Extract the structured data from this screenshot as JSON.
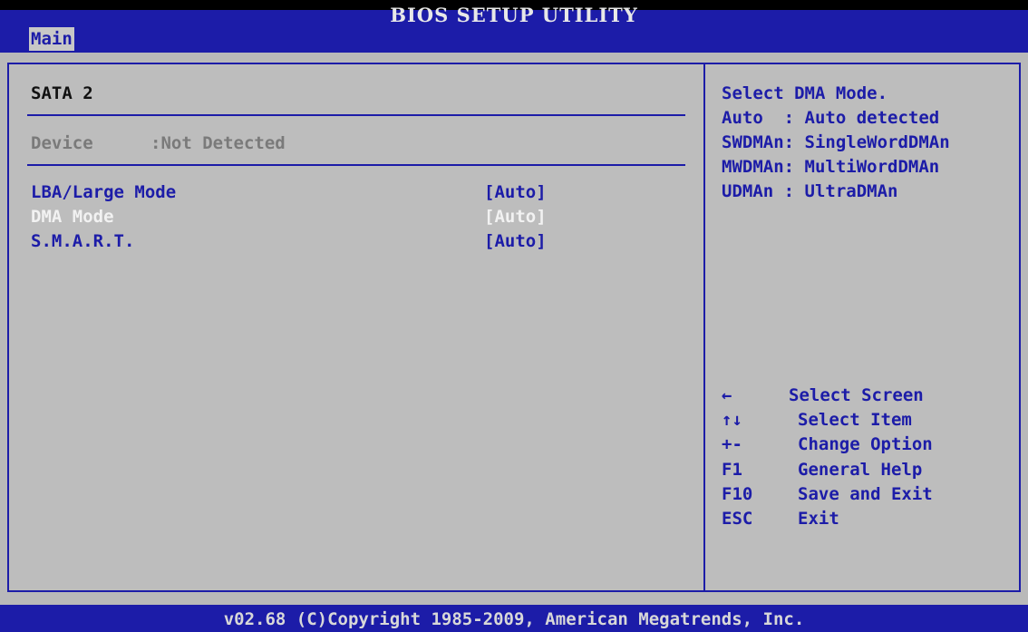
{
  "header": {
    "title": "BIOS SETUP UTILITY",
    "tab_main": "Main"
  },
  "left": {
    "section_title": "SATA 2",
    "device_label": "Device",
    "device_value": ":Not Detected",
    "options": [
      {
        "label": "LBA/Large Mode",
        "value": "[Auto]"
      },
      {
        "label": "DMA Mode",
        "value": "[Auto]",
        "selected": true
      },
      {
        "label": "S.M.A.R.T.",
        "value": "[Auto]"
      }
    ]
  },
  "help": {
    "lines": [
      "Select DMA Mode.",
      "Auto  : Auto detected",
      "SWDMAn: SingleWordDMAn",
      "MWDMAn: MultiWordDMAn",
      "UDMAn : UltraDMAn"
    ]
  },
  "keys": [
    {
      "key": "←",
      "desc": "Select Screen"
    },
    {
      "key": "↑↓",
      "desc": "Select Item"
    },
    {
      "key": "+-",
      "desc": "Change Option"
    },
    {
      "key": "F1",
      "desc": "General Help"
    },
    {
      "key": "F10",
      "desc": "Save and Exit"
    },
    {
      "key": "ESC",
      "desc": "Exit"
    }
  ],
  "footer": {
    "text": "v02.68 (C)Copyright 1985-2009, American Megatrends, Inc."
  },
  "colors": {
    "bios_blue": "#1c1ca8",
    "panel_grey": "#bdbdbd",
    "highlight_white": "#f2f2f2",
    "disabled_grey": "#7a7a7a"
  }
}
